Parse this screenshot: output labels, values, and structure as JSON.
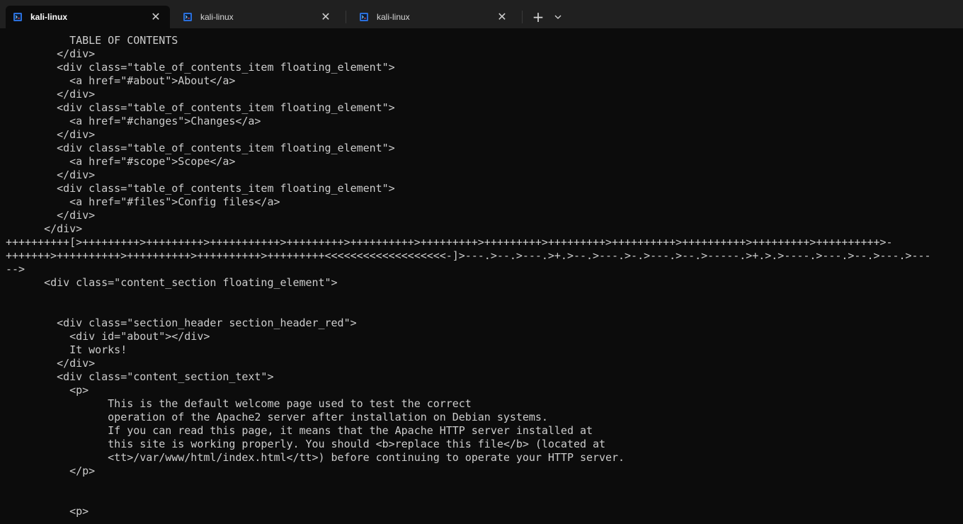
{
  "tabs": [
    {
      "label": "kali-linux",
      "active": true,
      "icon": "kali-terminal-icon"
    },
    {
      "label": "kali-linux",
      "active": false,
      "icon": "kali-terminal-icon"
    },
    {
      "label": "kali-linux",
      "active": false,
      "icon": "kali-terminal-icon"
    }
  ],
  "tab_actions": {
    "new_tab": "+",
    "dropdown": "⌄"
  },
  "terminal": {
    "lines": [
      "          TABLE OF CONTENTS",
      "        </div>",
      "        <div class=\"table_of_contents_item floating_element\">",
      "          <a href=\"#about\">About</a>",
      "        </div>",
      "        <div class=\"table_of_contents_item floating_element\">",
      "          <a href=\"#changes\">Changes</a>",
      "        </div>",
      "        <div class=\"table_of_contents_item floating_element\">",
      "          <a href=\"#scope\">Scope</a>",
      "        </div>",
      "        <div class=\"table_of_contents_item floating_element\">",
      "          <a href=\"#files\">Config files</a>",
      "        </div>",
      "      </div>",
      "++++++++++[>+++++++++>+++++++++>+++++++++++>+++++++++>++++++++++>+++++++++>+++++++++>+++++++++>++++++++++>++++++++++>+++++++++>++++++++++>-",
      "+++++++>++++++++++>++++++++++>++++++++++>+++++++++<<<<<<<<<<<<<<<<<<<-]>---.>--.>---.>+.>--.>---.>-.>---.>--.>-----.>+.>.>----.>---.>--.>---.>---",
      "-->",
      "      <div class=\"content_section floating_element\">",
      "",
      "",
      "        <div class=\"section_header section_header_red\">",
      "          <div id=\"about\"></div>",
      "          It works!",
      "        </div>",
      "        <div class=\"content_section_text\">",
      "          <p>",
      "                This is the default welcome page used to test the correct",
      "                operation of the Apache2 server after installation on Debian systems.",
      "                If you can read this page, it means that the Apache HTTP server installed at",
      "                this site is working properly. You should <b>replace this file</b> (located at",
      "                <tt>/var/www/html/index.html</tt>) before continuing to operate your HTTP server.",
      "          </p>",
      "",
      "",
      "          <p>"
    ]
  },
  "colors": {
    "background": "#0c0c0c",
    "tabbar": "#202020",
    "text": "#cccccc"
  }
}
